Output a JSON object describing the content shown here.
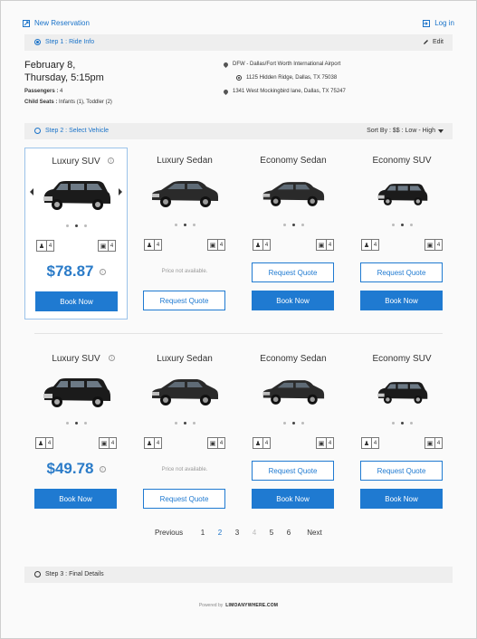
{
  "header": {
    "new_reservation": "New Reservation",
    "login": "Log in"
  },
  "step1": {
    "label": "Step 1 : Ride Info",
    "edit": "Edit"
  },
  "ride": {
    "date_line1": "February 8,",
    "date_line2": "Thursday, 5:15pm",
    "passengers_label": "Passengers :",
    "passengers_value": "4",
    "child_seats_label": "Child Seats :",
    "child_seats_value": "Infants (1), Toddler (2)",
    "pickup": "DFW - Dallas/Fort Worth International Airport",
    "stop": "1125 Hidden Ridge, Dallas, TX 75038",
    "dropoff": "1341 West Mockingbird lane, Dallas, TX 75247"
  },
  "step2": {
    "label": "Step 2 : Select Vehicle",
    "sort": "Sort By : $$ : Low - High"
  },
  "rows": [
    {
      "cards": [
        {
          "name": "Luxury SUV",
          "passengers": "4",
          "luggage": "4",
          "price": "$78.87",
          "quote_label": "",
          "book_label": "Book Now",
          "car": "suv",
          "selected": true
        },
        {
          "name": "Luxury Sedan",
          "passengers": "4",
          "luggage": "4",
          "unavailable": "Price not available.",
          "quote_label": "Request Quote",
          "car": "sedan"
        },
        {
          "name": "Economy Sedan",
          "passengers": "4",
          "luggage": "4",
          "quote_label": "Request Quote",
          "book_label": "Book Now",
          "car": "sedan2"
        },
        {
          "name": "Economy SUV",
          "passengers": "4",
          "luggage": "4",
          "quote_label": "Request Quote",
          "book_label": "Book Now",
          "car": "suv2"
        }
      ]
    },
    {
      "cards": [
        {
          "name": "Luxury SUV",
          "passengers": "4",
          "luggage": "4",
          "price": "$49.78",
          "book_label": "Book Now",
          "car": "suv"
        },
        {
          "name": "Luxury Sedan",
          "passengers": "4",
          "luggage": "4",
          "unavailable": "Price not available.",
          "quote_label": "Request Quote",
          "car": "sedan"
        },
        {
          "name": "Economy Sedan",
          "passengers": "4",
          "luggage": "4",
          "quote_label": "Request Quote",
          "book_label": "Book Now",
          "car": "sedan2"
        },
        {
          "name": "Economy SUV",
          "passengers": "4",
          "luggage": "4",
          "quote_label": "Request Quote",
          "book_label": "Book Now",
          "car": "suv2"
        }
      ]
    }
  ],
  "pager": {
    "previous": "Previous",
    "pages": [
      "1",
      "2",
      "3",
      "4",
      "5",
      "6"
    ],
    "current": "2",
    "disabled": "4",
    "next": "Next"
  },
  "step3": {
    "label": "Step 3 : Final Details"
  },
  "footer": {
    "powered": "Powered by",
    "brand": "LIMOANYWHERE.COM"
  },
  "colors": {
    "accent": "#1f7ad1",
    "price": "#2a7bc8"
  }
}
